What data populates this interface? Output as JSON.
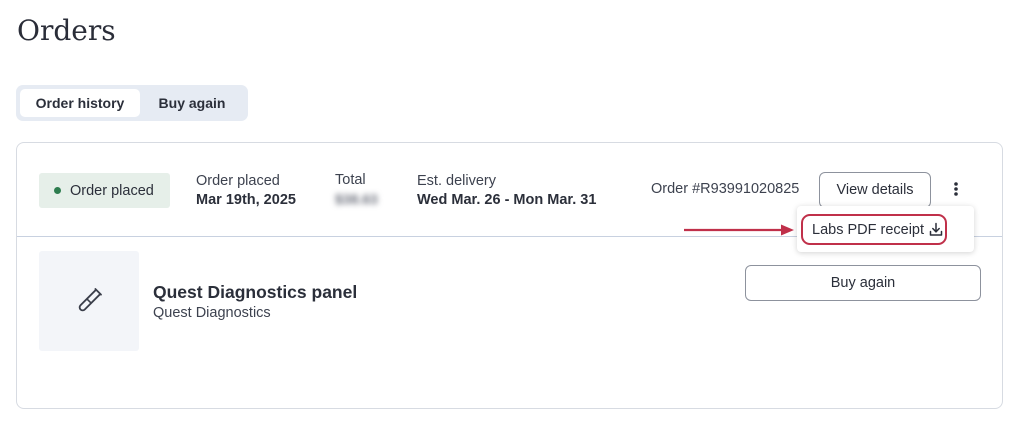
{
  "page": {
    "title": "Orders"
  },
  "tabs": [
    {
      "label": "Order history",
      "active": true
    },
    {
      "label": "Buy again",
      "active": false
    }
  ],
  "order": {
    "status": "Order placed",
    "status_color": "#2e7d4f",
    "placed_label": "Order placed",
    "placed_date": "Mar 19th, 2025",
    "total_label": "Total",
    "total_value": "$38.63",
    "delivery_label": "Est. delivery",
    "delivery_value": "Wed Mar. 26 - Mon Mar. 31",
    "order_number": "Order #R93991020825",
    "view_details_label": "View details",
    "more_icon": "kebab-vertical-icon",
    "menu": {
      "receipt_label": "Labs PDF receipt",
      "receipt_icon": "download-icon",
      "highlight_color": "#c0304a"
    }
  },
  "product": {
    "icon": "test-tube-icon",
    "name": "Quest Diagnostics panel",
    "vendor": "Quest Diagnostics",
    "buy_again_label": "Buy again"
  }
}
